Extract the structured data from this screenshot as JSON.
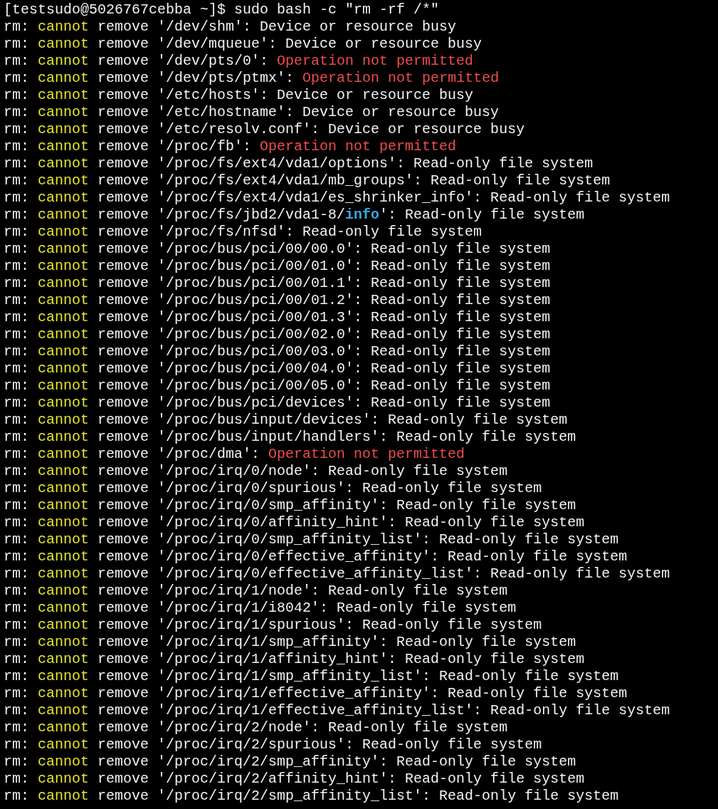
{
  "terminal": {
    "lines": [
      [
        {
          "text": "[testsudo@5026767cebba ~]$ sudo bash -c \"rm -rf /*\"",
          "kind": "plain"
        }
      ],
      [
        {
          "text": "rm: ",
          "kind": "plain"
        },
        {
          "text": "cannot",
          "kind": "warning"
        },
        {
          "text": " remove '/dev/shm': Device or resource busy",
          "kind": "plain"
        }
      ],
      [
        {
          "text": "rm: ",
          "kind": "plain"
        },
        {
          "text": "cannot",
          "kind": "warning"
        },
        {
          "text": " remove '/dev/mqueue': Device or resource busy",
          "kind": "plain"
        }
      ],
      [
        {
          "text": "rm: ",
          "kind": "plain"
        },
        {
          "text": "cannot",
          "kind": "warning"
        },
        {
          "text": " remove '/dev/pts/0': ",
          "kind": "plain"
        },
        {
          "text": "Operation not permitted",
          "kind": "error"
        }
      ],
      [
        {
          "text": "rm: ",
          "kind": "plain"
        },
        {
          "text": "cannot",
          "kind": "warning"
        },
        {
          "text": " remove '/dev/pts/ptmx': ",
          "kind": "plain"
        },
        {
          "text": "Operation not permitted",
          "kind": "error"
        }
      ],
      [
        {
          "text": "rm: ",
          "kind": "plain"
        },
        {
          "text": "cannot",
          "kind": "warning"
        },
        {
          "text": " remove '/etc/hosts': Device or resource busy",
          "kind": "plain"
        }
      ],
      [
        {
          "text": "rm: ",
          "kind": "plain"
        },
        {
          "text": "cannot",
          "kind": "warning"
        },
        {
          "text": " remove '/etc/hostname': Device or resource busy",
          "kind": "plain"
        }
      ],
      [
        {
          "text": "rm: ",
          "kind": "plain"
        },
        {
          "text": "cannot",
          "kind": "warning"
        },
        {
          "text": " remove '/etc/resolv.conf': Device or resource busy",
          "kind": "plain"
        }
      ],
      [
        {
          "text": "rm: ",
          "kind": "plain"
        },
        {
          "text": "cannot",
          "kind": "warning"
        },
        {
          "text": " remove '/proc/fb': ",
          "kind": "plain"
        },
        {
          "text": "Operation not permitted",
          "kind": "error"
        }
      ],
      [
        {
          "text": "rm: ",
          "kind": "plain"
        },
        {
          "text": "cannot",
          "kind": "warning"
        },
        {
          "text": " remove '/proc/fs/ext4/vda1/options': Read-only file system",
          "kind": "plain"
        }
      ],
      [
        {
          "text": "rm: ",
          "kind": "plain"
        },
        {
          "text": "cannot",
          "kind": "warning"
        },
        {
          "text": " remove '/proc/fs/ext4/vda1/mb_groups': Read-only file system",
          "kind": "plain"
        }
      ],
      [
        {
          "text": "rm: ",
          "kind": "plain"
        },
        {
          "text": "cannot",
          "kind": "warning"
        },
        {
          "text": " remove '/proc/fs/ext4/vda1/es_shrinker_info': Read-only file system",
          "kind": "plain"
        }
      ],
      [
        {
          "text": "rm: ",
          "kind": "plain"
        },
        {
          "text": "cannot",
          "kind": "warning"
        },
        {
          "text": " remove '/proc/fs/jbd2/vda1-8/",
          "kind": "plain"
        },
        {
          "text": "info",
          "kind": "directory"
        },
        {
          "text": "': Read-only file system",
          "kind": "plain"
        }
      ],
      [
        {
          "text": "rm: ",
          "kind": "plain"
        },
        {
          "text": "cannot",
          "kind": "warning"
        },
        {
          "text": " remove '/proc/fs/nfsd': Read-only file system",
          "kind": "plain"
        }
      ],
      [
        {
          "text": "rm: ",
          "kind": "plain"
        },
        {
          "text": "cannot",
          "kind": "warning"
        },
        {
          "text": " remove '/proc/bus/pci/00/00.0': Read-only file system",
          "kind": "plain"
        }
      ],
      [
        {
          "text": "rm: ",
          "kind": "plain"
        },
        {
          "text": "cannot",
          "kind": "warning"
        },
        {
          "text": " remove '/proc/bus/pci/00/01.0': Read-only file system",
          "kind": "plain"
        }
      ],
      [
        {
          "text": "rm: ",
          "kind": "plain"
        },
        {
          "text": "cannot",
          "kind": "warning"
        },
        {
          "text": " remove '/proc/bus/pci/00/01.1': Read-only file system",
          "kind": "plain"
        }
      ],
      [
        {
          "text": "rm: ",
          "kind": "plain"
        },
        {
          "text": "cannot",
          "kind": "warning"
        },
        {
          "text": " remove '/proc/bus/pci/00/01.2': Read-only file system",
          "kind": "plain"
        }
      ],
      [
        {
          "text": "rm: ",
          "kind": "plain"
        },
        {
          "text": "cannot",
          "kind": "warning"
        },
        {
          "text": " remove '/proc/bus/pci/00/01.3': Read-only file system",
          "kind": "plain"
        }
      ],
      [
        {
          "text": "rm: ",
          "kind": "plain"
        },
        {
          "text": "cannot",
          "kind": "warning"
        },
        {
          "text": " remove '/proc/bus/pci/00/02.0': Read-only file system",
          "kind": "plain"
        }
      ],
      [
        {
          "text": "rm: ",
          "kind": "plain"
        },
        {
          "text": "cannot",
          "kind": "warning"
        },
        {
          "text": " remove '/proc/bus/pci/00/03.0': Read-only file system",
          "kind": "plain"
        }
      ],
      [
        {
          "text": "rm: ",
          "kind": "plain"
        },
        {
          "text": "cannot",
          "kind": "warning"
        },
        {
          "text": " remove '/proc/bus/pci/00/04.0': Read-only file system",
          "kind": "plain"
        }
      ],
      [
        {
          "text": "rm: ",
          "kind": "plain"
        },
        {
          "text": "cannot",
          "kind": "warning"
        },
        {
          "text": " remove '/proc/bus/pci/00/05.0': Read-only file system",
          "kind": "plain"
        }
      ],
      [
        {
          "text": "rm: ",
          "kind": "plain"
        },
        {
          "text": "cannot",
          "kind": "warning"
        },
        {
          "text": " remove '/proc/bus/pci/devices': Read-only file system",
          "kind": "plain"
        }
      ],
      [
        {
          "text": "rm: ",
          "kind": "plain"
        },
        {
          "text": "cannot",
          "kind": "warning"
        },
        {
          "text": " remove '/proc/bus/input/devices': Read-only file system",
          "kind": "plain"
        }
      ],
      [
        {
          "text": "rm: ",
          "kind": "plain"
        },
        {
          "text": "cannot",
          "kind": "warning"
        },
        {
          "text": " remove '/proc/bus/input/handlers': Read-only file system",
          "kind": "plain"
        }
      ],
      [
        {
          "text": "rm: ",
          "kind": "plain"
        },
        {
          "text": "cannot",
          "kind": "warning"
        },
        {
          "text": " remove '/proc/dma': ",
          "kind": "plain"
        },
        {
          "text": "Operation not permitted",
          "kind": "error"
        }
      ],
      [
        {
          "text": "rm: ",
          "kind": "plain"
        },
        {
          "text": "cannot",
          "kind": "warning"
        },
        {
          "text": " remove '/proc/irq/0/node': Read-only file system",
          "kind": "plain"
        }
      ],
      [
        {
          "text": "rm: ",
          "kind": "plain"
        },
        {
          "text": "cannot",
          "kind": "warning"
        },
        {
          "text": " remove '/proc/irq/0/spurious': Read-only file system",
          "kind": "plain"
        }
      ],
      [
        {
          "text": "rm: ",
          "kind": "plain"
        },
        {
          "text": "cannot",
          "kind": "warning"
        },
        {
          "text": " remove '/proc/irq/0/smp_affinity': Read-only file system",
          "kind": "plain"
        }
      ],
      [
        {
          "text": "rm: ",
          "kind": "plain"
        },
        {
          "text": "cannot",
          "kind": "warning"
        },
        {
          "text": " remove '/proc/irq/0/affinity_hint': Read-only file system",
          "kind": "plain"
        }
      ],
      [
        {
          "text": "rm: ",
          "kind": "plain"
        },
        {
          "text": "cannot",
          "kind": "warning"
        },
        {
          "text": " remove '/proc/irq/0/smp_affinity_list': Read-only file system",
          "kind": "plain"
        }
      ],
      [
        {
          "text": "rm: ",
          "kind": "plain"
        },
        {
          "text": "cannot",
          "kind": "warning"
        },
        {
          "text": " remove '/proc/irq/0/effective_affinity': Read-only file system",
          "kind": "plain"
        }
      ],
      [
        {
          "text": "rm: ",
          "kind": "plain"
        },
        {
          "text": "cannot",
          "kind": "warning"
        },
        {
          "text": " remove '/proc/irq/0/effective_affinity_list': Read-only file system",
          "kind": "plain"
        }
      ],
      [
        {
          "text": "rm: ",
          "kind": "plain"
        },
        {
          "text": "cannot",
          "kind": "warning"
        },
        {
          "text": " remove '/proc/irq/1/node': Read-only file system",
          "kind": "plain"
        }
      ],
      [
        {
          "text": "rm: ",
          "kind": "plain"
        },
        {
          "text": "cannot",
          "kind": "warning"
        },
        {
          "text": " remove '/proc/irq/1/i8042': Read-only file system",
          "kind": "plain"
        }
      ],
      [
        {
          "text": "rm: ",
          "kind": "plain"
        },
        {
          "text": "cannot",
          "kind": "warning"
        },
        {
          "text": " remove '/proc/irq/1/spurious': Read-only file system",
          "kind": "plain"
        }
      ],
      [
        {
          "text": "rm: ",
          "kind": "plain"
        },
        {
          "text": "cannot",
          "kind": "warning"
        },
        {
          "text": " remove '/proc/irq/1/smp_affinity': Read-only file system",
          "kind": "plain"
        }
      ],
      [
        {
          "text": "rm: ",
          "kind": "plain"
        },
        {
          "text": "cannot",
          "kind": "warning"
        },
        {
          "text": " remove '/proc/irq/1/affinity_hint': Read-only file system",
          "kind": "plain"
        }
      ],
      [
        {
          "text": "rm: ",
          "kind": "plain"
        },
        {
          "text": "cannot",
          "kind": "warning"
        },
        {
          "text": " remove '/proc/irq/1/smp_affinity_list': Read-only file system",
          "kind": "plain"
        }
      ],
      [
        {
          "text": "rm: ",
          "kind": "plain"
        },
        {
          "text": "cannot",
          "kind": "warning"
        },
        {
          "text": " remove '/proc/irq/1/effective_affinity': Read-only file system",
          "kind": "plain"
        }
      ],
      [
        {
          "text": "rm: ",
          "kind": "plain"
        },
        {
          "text": "cannot",
          "kind": "warning"
        },
        {
          "text": " remove '/proc/irq/1/effective_affinity_list': Read-only file system",
          "kind": "plain"
        }
      ],
      [
        {
          "text": "rm: ",
          "kind": "plain"
        },
        {
          "text": "cannot",
          "kind": "warning"
        },
        {
          "text": " remove '/proc/irq/2/node': Read-only file system",
          "kind": "plain"
        }
      ],
      [
        {
          "text": "rm: ",
          "kind": "plain"
        },
        {
          "text": "cannot",
          "kind": "warning"
        },
        {
          "text": " remove '/proc/irq/2/spurious': Read-only file system",
          "kind": "plain"
        }
      ],
      [
        {
          "text": "rm: ",
          "kind": "plain"
        },
        {
          "text": "cannot",
          "kind": "warning"
        },
        {
          "text": " remove '/proc/irq/2/smp_affinity': Read-only file system",
          "kind": "plain"
        }
      ],
      [
        {
          "text": "rm: ",
          "kind": "plain"
        },
        {
          "text": "cannot",
          "kind": "warning"
        },
        {
          "text": " remove '/proc/irq/2/affinity_hint': Read-only file system",
          "kind": "plain"
        }
      ],
      [
        {
          "text": "rm: ",
          "kind": "plain"
        },
        {
          "text": "cannot",
          "kind": "warning"
        },
        {
          "text": " remove '/proc/irq/2/smp_affinity_list': Read-only file system",
          "kind": "plain"
        }
      ]
    ]
  }
}
